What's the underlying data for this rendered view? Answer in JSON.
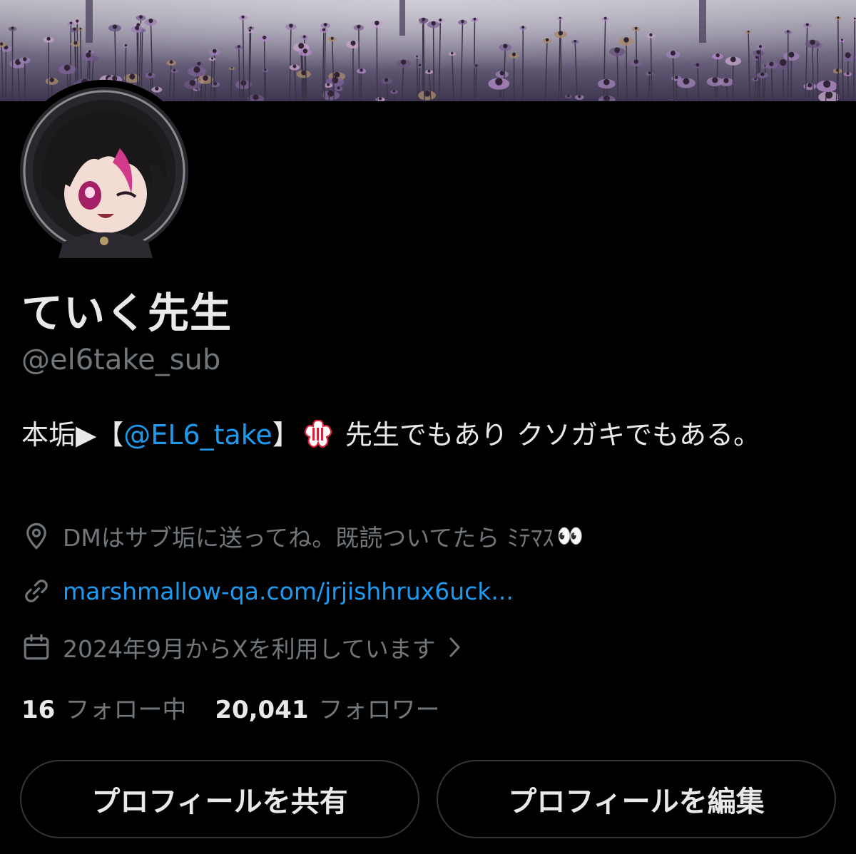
{
  "profile": {
    "display_name": "ていく先生",
    "handle": "@el6take_sub",
    "bio": {
      "prefix": "本垢▶【",
      "mention": "@EL6_take",
      "suffix_bracket": "】",
      "stamp_text": "大変よくできました",
      "tail": " 先生でもあり クソガキでもある。"
    },
    "location": "DMはサブ垢に送ってね。既読ついてたら ﾐﾃﾏｽ",
    "location_emoji": "👀",
    "website": "marshmallow-qa.com/jrjishhrux6uck...",
    "joined": "2024年9月からXを利用しています",
    "following_count": "16",
    "following_label": "フォロー中",
    "followers_count": "20,041",
    "followers_label": "フォロワー"
  },
  "actions": {
    "share_label": "プロフィールを共有",
    "edit_label": "プロフィールを編集"
  },
  "icons": {
    "location": "location-pin-icon",
    "link": "link-icon",
    "calendar": "calendar-icon",
    "chevron": "chevron-right-icon"
  },
  "colors": {
    "background": "#000000",
    "text_primary": "#e7e9ea",
    "text_secondary": "#71767b",
    "link": "#1d9bf0",
    "button_border": "#333639"
  }
}
